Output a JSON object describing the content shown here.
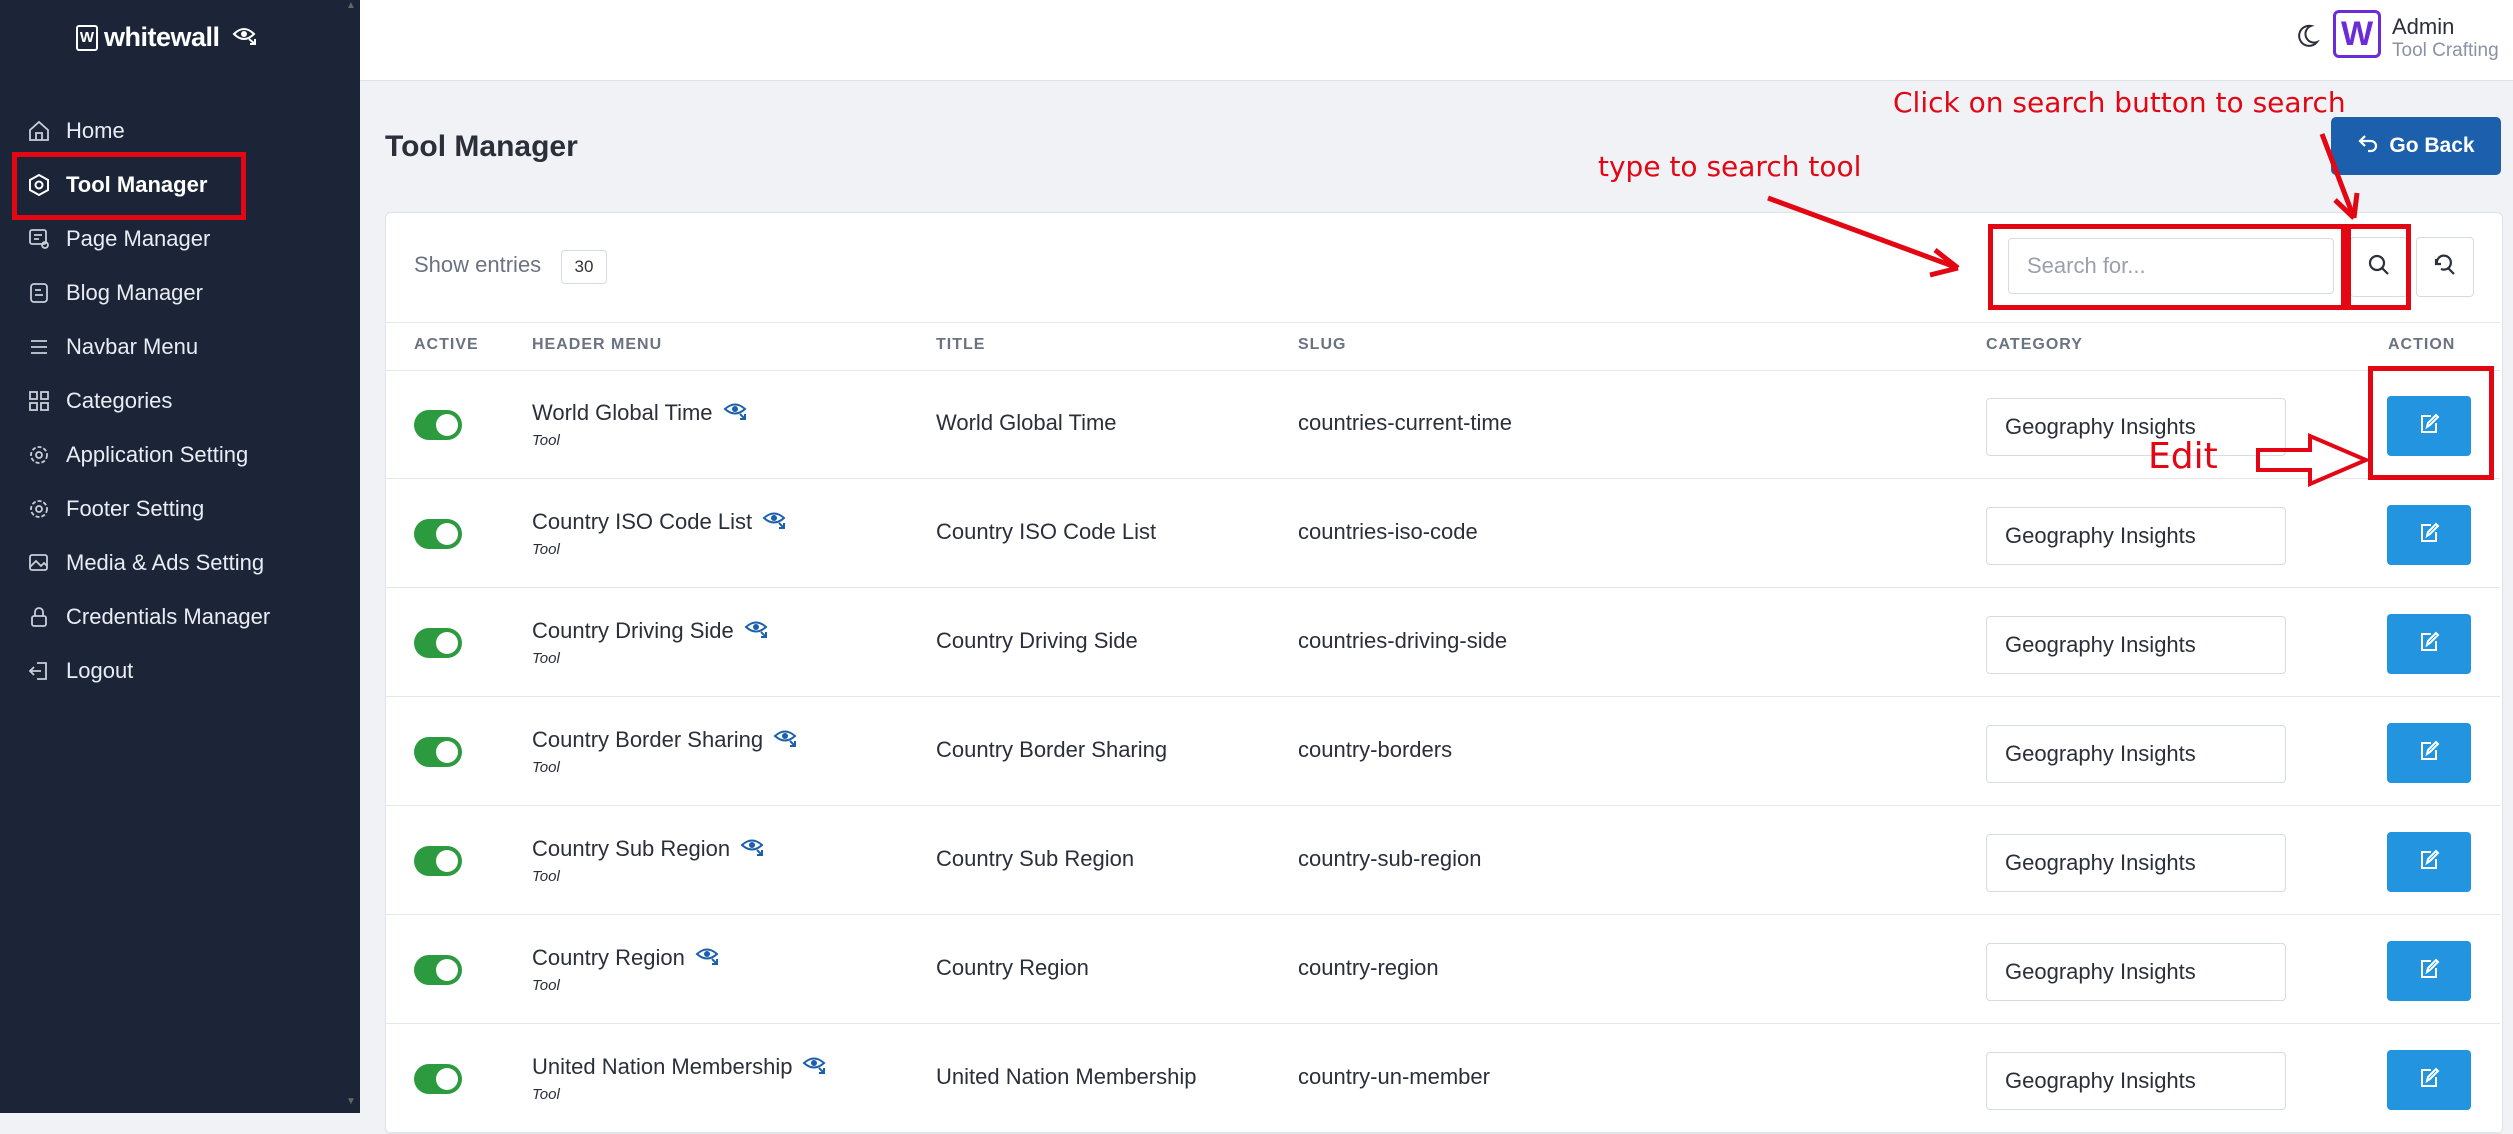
{
  "brand": {
    "name": "whitewall",
    "mark": "W"
  },
  "sidebar": {
    "items": [
      {
        "label": "Home",
        "icon": "home-icon"
      },
      {
        "label": "Tool Manager",
        "icon": "hexagon-settings-icon",
        "active": true
      },
      {
        "label": "Page Manager",
        "icon": "page-settings-icon"
      },
      {
        "label": "Blog Manager",
        "icon": "blog-icon"
      },
      {
        "label": "Navbar Menu",
        "icon": "menu-icon"
      },
      {
        "label": "Categories",
        "icon": "grid-icon"
      },
      {
        "label": "Application Setting",
        "icon": "gear-icon"
      },
      {
        "label": "Footer Setting",
        "icon": "gear-icon"
      },
      {
        "label": "Media & Ads Setting",
        "icon": "image-icon"
      },
      {
        "label": "Credentials Manager",
        "icon": "lock-icon"
      },
      {
        "label": "Logout",
        "icon": "logout-icon"
      }
    ]
  },
  "header": {
    "admin_logo": "W",
    "admin_name": "Admin",
    "admin_role": "Tool Crafting"
  },
  "page": {
    "title": "Tool Manager",
    "go_back_label": "Go Back",
    "show_entries_label": "Show entries",
    "entries_value": "30",
    "search_placeholder": "Search for..."
  },
  "table": {
    "columns": {
      "active": "ACTIVE",
      "header_menu": "HEADER MENU",
      "title": "TITLE",
      "slug": "SLUG",
      "category": "CATEGORY",
      "action": "ACTION"
    },
    "rows": [
      {
        "header_menu": "World Global Time",
        "type": "Tool",
        "title": "World Global Time",
        "slug": "countries-current-time",
        "category": "Geography Insights",
        "active": true
      },
      {
        "header_menu": "Country ISO Code List",
        "type": "Tool",
        "title": "Country ISO Code List",
        "slug": "countries-iso-code",
        "category": "Geography Insights",
        "active": true
      },
      {
        "header_menu": "Country Driving Side",
        "type": "Tool",
        "title": "Country Driving Side",
        "slug": "countries-driving-side",
        "category": "Geography Insights",
        "active": true
      },
      {
        "header_menu": "Country Border Sharing",
        "type": "Tool",
        "title": "Country Border Sharing",
        "slug": "country-borders",
        "category": "Geography Insights",
        "active": true
      },
      {
        "header_menu": "Country Sub Region",
        "type": "Tool",
        "title": "Country Sub Region",
        "slug": "country-sub-region",
        "category": "Geography Insights",
        "active": true
      },
      {
        "header_menu": "Country Region",
        "type": "Tool",
        "title": "Country Region",
        "slug": "country-region",
        "category": "Geography Insights",
        "active": true
      },
      {
        "header_menu": "United Nation Membership",
        "type": "Tool",
        "title": "United Nation Membership",
        "slug": "country-un-member",
        "category": "Geography Insights",
        "active": true
      }
    ]
  },
  "annotations": {
    "search_button_note": "Click on search button to search",
    "search_field_note": "type to search tool",
    "edit_note": "Edit"
  },
  "colors": {
    "sidebar_bg": "#1b2537",
    "accent": "#1b5fad",
    "edit_button": "#2294e0",
    "toggle_on": "#2c9a3f",
    "annotation_red": "#e30613"
  }
}
